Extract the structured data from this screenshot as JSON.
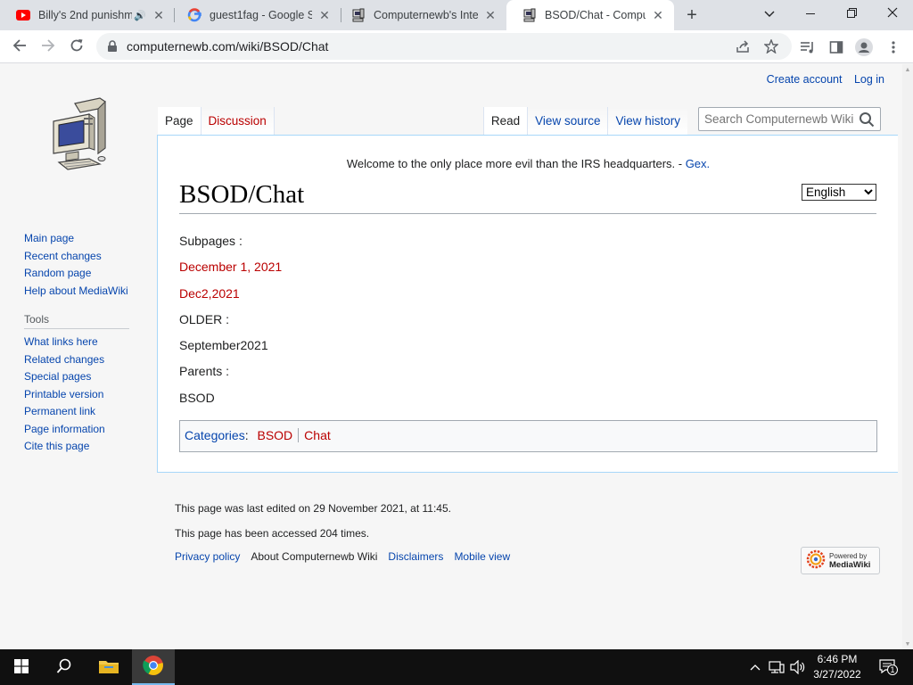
{
  "browser": {
    "tabs": [
      {
        "title": "Billy's 2nd punishm",
        "icon": "youtube-icon",
        "active": false
      },
      {
        "title": "guest1fag - Google Se",
        "icon": "google-icon",
        "active": false
      },
      {
        "title": "Computernewb's Inter",
        "icon": "computernewb-icon",
        "active": false
      },
      {
        "title": "BSOD/Chat - Compute",
        "icon": "computernewb-icon",
        "active": true
      }
    ],
    "url": "computernewb.com/wiki/BSOD/Chat"
  },
  "personal": {
    "create_account": "Create account",
    "log_in": "Log in"
  },
  "sidebar": {
    "navigation": [
      "Main page",
      "Recent changes",
      "Random page",
      "Help about MediaWiki"
    ],
    "tools_heading": "Tools",
    "tools": [
      "What links here",
      "Related changes",
      "Special pages",
      "Printable version",
      "Permanent link",
      "Page information",
      "Cite this page"
    ]
  },
  "tabs": {
    "page": "Page",
    "discussion": "Discussion",
    "read": "Read",
    "view_source": "View source",
    "view_history": "View history"
  },
  "search": {
    "placeholder": "Search Computernewb Wiki"
  },
  "sitenotice": {
    "text": "Welcome to the only place more evil than the IRS headquarters. - ",
    "author": "Gex."
  },
  "language": {
    "selected": "English"
  },
  "article": {
    "title": "BSOD/Chat",
    "subpages_label": "Subpages :",
    "subpage_1": "December 1, 2021",
    "subpage_2": "Dec2,2021",
    "older_label": "OLDER :",
    "older_1": "September2021",
    "parents_label": "Parents :",
    "parent_1": "BSOD"
  },
  "categories": {
    "label": "Categories",
    "items": [
      "BSOD",
      "Chat"
    ]
  },
  "footer": {
    "last_edited": "This page was last edited on 29 November 2021, at 11:45.",
    "accessed": "This page has been accessed 204 times.",
    "links": [
      "Privacy policy",
      "About Computernewb Wiki",
      "Disclaimers",
      "Mobile view"
    ],
    "powered_by_1": "Powered by",
    "powered_by_2": "MediaWiki"
  },
  "taskbar": {
    "time": "6:46 PM",
    "date": "3/27/2022",
    "notification_count": "1"
  },
  "colors": {
    "link": "#0645ad",
    "redlink": "#ba0000",
    "content_border": "#a7d7f9"
  }
}
